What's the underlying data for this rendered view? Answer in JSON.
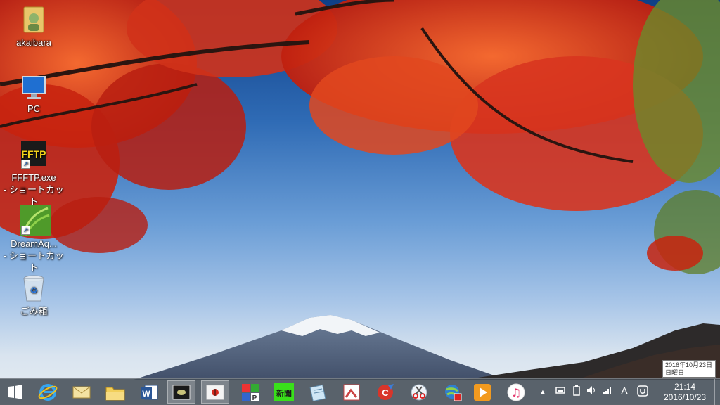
{
  "desktop": {
    "icons": [
      {
        "label": "akaibara",
        "icon": "user-folder-icon"
      },
      {
        "label": "PC",
        "icon": "computer-icon"
      },
      {
        "label": "FFFTP.exe\n- ショートカット",
        "label_line1": "FFFTP.exe",
        "label_line2": "- ショートカット",
        "icon": "ffftp-icon",
        "icon_text": "FFTP"
      },
      {
        "label_line1": "DreamAq...",
        "label_line2": "- ショートカット",
        "icon": "dreamaquarium-icon"
      },
      {
        "label": "ごみ箱",
        "icon": "recycle-bin-icon"
      }
    ]
  },
  "tooltip": {
    "date_line": "2016年10月23日",
    "weekday_line": "日曜日"
  },
  "taskbar": {
    "start_icon": "windows-logo-icon",
    "pinned": [
      {
        "name": "internet-explorer",
        "icon": "internet-explorer-icon",
        "glyph": "e"
      },
      {
        "name": "mail",
        "icon": "mail-icon"
      },
      {
        "name": "file-explorer",
        "icon": "folder-icon"
      },
      {
        "name": "word",
        "icon": "word-icon",
        "glyph": "W"
      },
      {
        "name": "app-window-1",
        "icon": "app-window-icon",
        "active": true
      },
      {
        "name": "app-window-2",
        "icon": "ladybug-app-icon",
        "active": true
      },
      {
        "name": "paint-app",
        "icon": "paint-icon",
        "glyph": "P"
      },
      {
        "name": "news-app",
        "icon": "news-app-icon",
        "glyph": "新聞"
      },
      {
        "name": "notepad",
        "icon": "notepad-icon"
      },
      {
        "name": "image-viewer",
        "icon": "image-viewer-icon"
      },
      {
        "name": "ccleaner",
        "icon": "ccleaner-icon",
        "glyph": "C"
      },
      {
        "name": "snipping-tool",
        "icon": "scissors-icon"
      },
      {
        "name": "network-app",
        "icon": "globe-icon"
      },
      {
        "name": "media-player",
        "icon": "play-icon"
      },
      {
        "name": "itunes",
        "icon": "music-note-icon",
        "glyph": "♫"
      }
    ],
    "tray": {
      "chevron": "▲",
      "ime": "A",
      "time": "21:14",
      "date": "2016/10/23"
    }
  },
  "colors": {
    "sky_top": "#0f3f86",
    "leaves": "#d8351f",
    "taskbar": "#464e58"
  }
}
